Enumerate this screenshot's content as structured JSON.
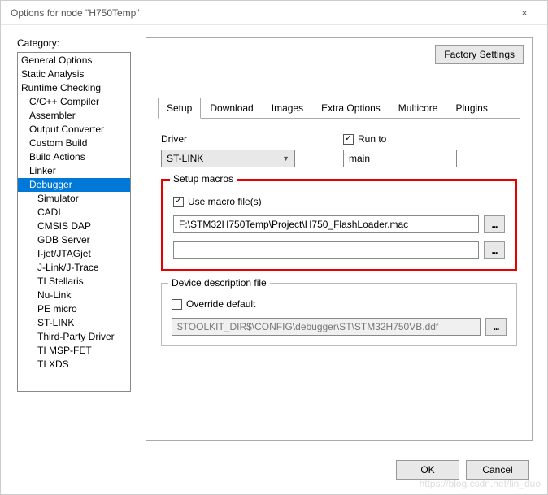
{
  "window": {
    "title": "Options for node \"H750Temp\"",
    "close_icon": "×"
  },
  "category": {
    "label": "Category:",
    "items": [
      {
        "label": "General Options",
        "indent": 0
      },
      {
        "label": "Static Analysis",
        "indent": 0
      },
      {
        "label": "Runtime Checking",
        "indent": 0
      },
      {
        "label": "C/C++ Compiler",
        "indent": 1
      },
      {
        "label": "Assembler",
        "indent": 1
      },
      {
        "label": "Output Converter",
        "indent": 1
      },
      {
        "label": "Custom Build",
        "indent": 1
      },
      {
        "label": "Build Actions",
        "indent": 1
      },
      {
        "label": "Linker",
        "indent": 1
      },
      {
        "label": "Debugger",
        "indent": 1,
        "selected": true
      },
      {
        "label": "Simulator",
        "indent": 2
      },
      {
        "label": "CADI",
        "indent": 2
      },
      {
        "label": "CMSIS DAP",
        "indent": 2
      },
      {
        "label": "GDB Server",
        "indent": 2
      },
      {
        "label": "I-jet/JTAGjet",
        "indent": 2
      },
      {
        "label": "J-Link/J-Trace",
        "indent": 2
      },
      {
        "label": "TI Stellaris",
        "indent": 2
      },
      {
        "label": "Nu-Link",
        "indent": 2
      },
      {
        "label": "PE micro",
        "indent": 2
      },
      {
        "label": "ST-LINK",
        "indent": 2
      },
      {
        "label": "Third-Party Driver",
        "indent": 2
      },
      {
        "label": "TI MSP-FET",
        "indent": 2
      },
      {
        "label": "TI XDS",
        "indent": 2
      }
    ]
  },
  "panel": {
    "factory_settings": "Factory Settings",
    "tabs": [
      "Setup",
      "Download",
      "Images",
      "Extra Options",
      "Multicore",
      "Plugins"
    ],
    "active_tab": 0,
    "driver_label": "Driver",
    "driver_value": "ST-LINK",
    "runto_label": "Run to",
    "runto_checked": true,
    "runto_value": "main",
    "macros": {
      "legend": "Setup macros",
      "use_macro_label": "Use macro file(s)",
      "use_macro_checked": true,
      "file1": "F:\\STM32H750Temp\\Project\\H750_FlashLoader.mac",
      "file2": ""
    },
    "ddf": {
      "legend": "Device description file",
      "override_label": "Override default",
      "override_checked": false,
      "path": "$TOOLKIT_DIR$\\CONFIG\\debugger\\ST\\STM32H750VB.ddf"
    },
    "browse_label": "..."
  },
  "buttons": {
    "ok": "OK",
    "cancel": "Cancel"
  },
  "watermark": "https://blog.csdn.net/lin_duo"
}
